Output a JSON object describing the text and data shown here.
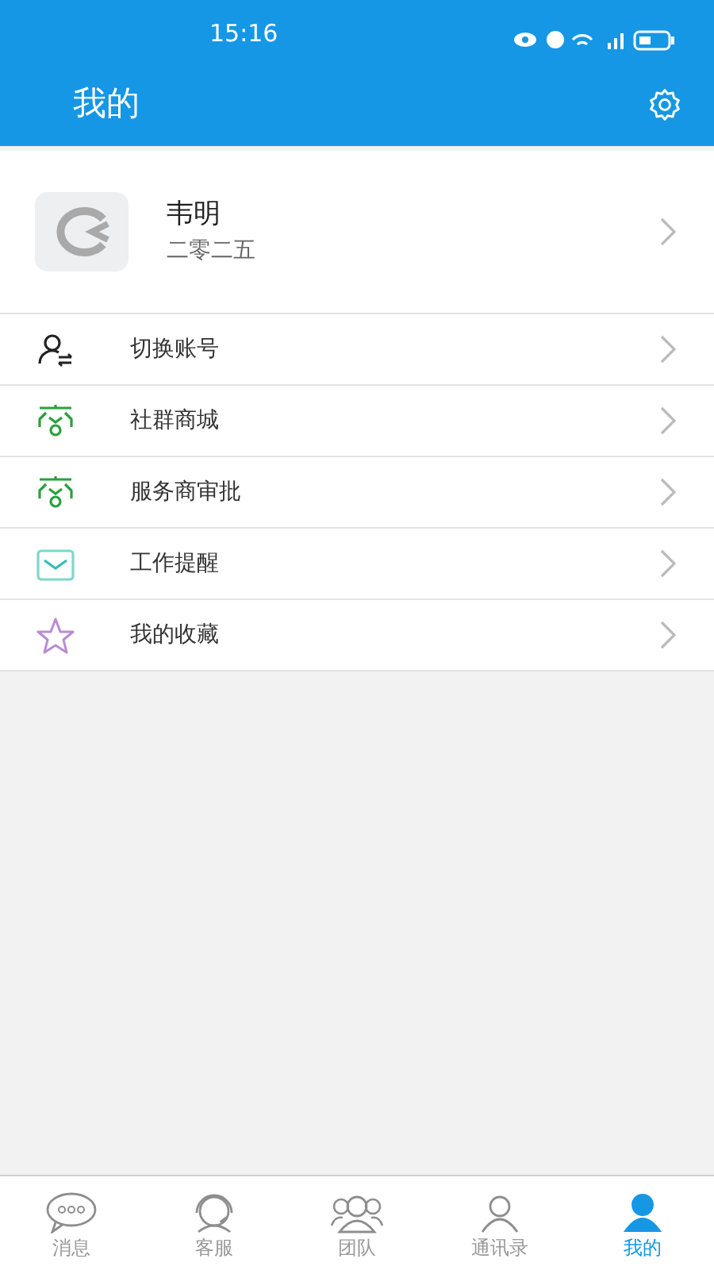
{
  "status_bar": {
    "time": "15:16"
  },
  "header": {
    "title": "我的"
  },
  "profile": {
    "name": "韦明",
    "subtitle": "二零二五"
  },
  "menu": [
    {
      "kind": "switch-user",
      "label": "切换账号"
    },
    {
      "kind": "shop",
      "label": "社群商城"
    },
    {
      "kind": "shop",
      "label": "服务商审批"
    },
    {
      "kind": "mail",
      "label": "工作提醒"
    },
    {
      "kind": "star",
      "label": "我的收藏"
    }
  ],
  "tabs": [
    {
      "kind": "chat",
      "label": "消息",
      "selected": false
    },
    {
      "kind": "service",
      "label": "客服",
      "selected": false
    },
    {
      "kind": "team",
      "label": "团队",
      "selected": false
    },
    {
      "kind": "contacts",
      "label": "通讯录",
      "selected": false
    },
    {
      "kind": "me",
      "label": "我的",
      "selected": true
    }
  ]
}
